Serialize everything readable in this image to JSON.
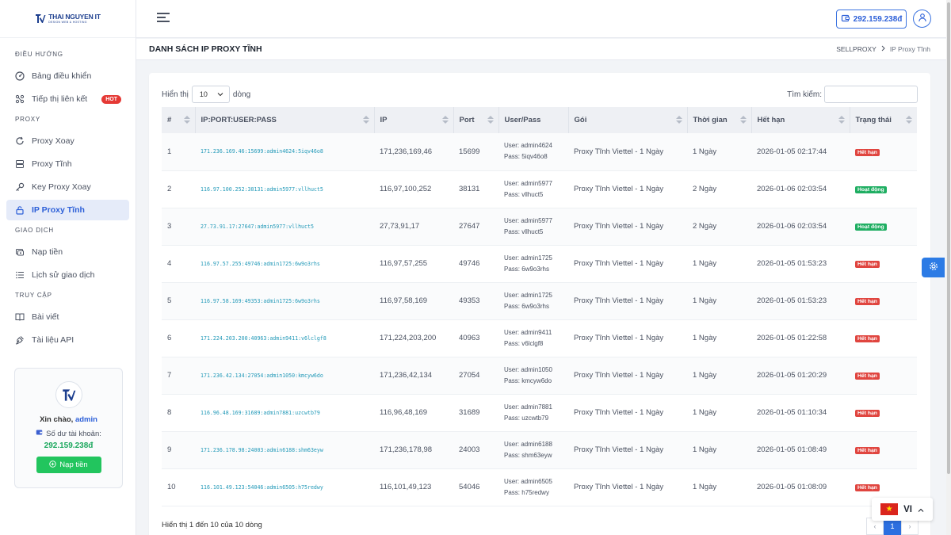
{
  "brand": {
    "name": "THAI NGUYEN IT",
    "tagline": "DESIGN WEB & HOSTING"
  },
  "sidebar": {
    "sections": [
      {
        "title": "ĐIỀU HƯỚNG",
        "items": [
          {
            "label": "Bảng điều khiển",
            "icon": "dashboard-icon"
          },
          {
            "label": "Tiếp thị liên kết",
            "icon": "share-icon",
            "badge": "HOT"
          }
        ]
      },
      {
        "title": "PROXY",
        "items": [
          {
            "label": "Proxy Xoay",
            "icon": "refresh-icon"
          },
          {
            "label": "Proxy Tĩnh",
            "icon": "server-icon"
          },
          {
            "label": "Key Proxy Xoay",
            "icon": "key-icon"
          },
          {
            "label": "IP Proxy Tĩnh",
            "icon": "lock-icon",
            "active": true
          }
        ]
      },
      {
        "title": "GIAO DỊCH",
        "items": [
          {
            "label": "Nạp tiền",
            "icon": "wallet-icon"
          },
          {
            "label": "Lịch sử giao dịch",
            "icon": "list-icon"
          }
        ]
      },
      {
        "title": "TRUY CẬP",
        "items": [
          {
            "label": "Bài viết",
            "icon": "book-icon"
          },
          {
            "label": "Tài liệu API",
            "icon": "plug-icon"
          }
        ]
      }
    ],
    "user_card": {
      "greeting": "Xin chào,",
      "username": "admin",
      "balance_label": "Số dư tài khoản:",
      "balance": "292.159.238đ",
      "topup_label": "Nạp tiền"
    }
  },
  "topbar": {
    "balance": "292.159.238đ"
  },
  "page": {
    "title": "DANH SÁCH IP PROXY TĨNH",
    "breadcrumb": [
      "SELLPROXY",
      "IP Proxy Tĩnh"
    ]
  },
  "table_controls": {
    "show_prefix": "Hiển thị",
    "page_size": "10",
    "show_suffix": "dòng",
    "search_label": "Tìm kiếm:",
    "search_value": ""
  },
  "table": {
    "columns": [
      "#",
      "IP:PORT:USER:PASS",
      "IP",
      "Port",
      "User/Pass",
      "Gói",
      "Thời gian",
      "Hết hạn",
      "Trạng thái"
    ],
    "user_prefix": "User:",
    "pass_prefix": "Pass:",
    "rows": [
      {
        "n": "1",
        "full": "171.236.169.46:15699:admin4624:5iqv46o8",
        "ip": "171,236,169,46",
        "port": "15699",
        "user": "admin4624",
        "pass": "5iqv46o8",
        "plan": "Proxy Tĩnh Viettel - 1 Ngày",
        "duration": "1 Ngày",
        "expires": "2026-01-05 02:17:44",
        "status": "Hết hạn",
        "status_kind": "expired"
      },
      {
        "n": "2",
        "full": "116.97.100.252:38131:admin5977:vllhuct5",
        "ip": "116,97,100,252",
        "port": "38131",
        "user": "admin5977",
        "pass": "vllhuct5",
        "plan": "Proxy Tĩnh Viettel - 1 Ngày",
        "duration": "2 Ngày",
        "expires": "2026-01-06 02:03:54",
        "status": "Hoạt động",
        "status_kind": "active"
      },
      {
        "n": "3",
        "full": "27.73.91.17:27647:admin5977:vllhuct5",
        "ip": "27,73,91,17",
        "port": "27647",
        "user": "admin5977",
        "pass": "vllhuct5",
        "plan": "Proxy Tĩnh Viettel - 1 Ngày",
        "duration": "2 Ngày",
        "expires": "2026-01-06 02:03:54",
        "status": "Hoạt động",
        "status_kind": "active"
      },
      {
        "n": "4",
        "full": "116.97.57.255:49746:admin1725:6w9o3rhs",
        "ip": "116,97,57,255",
        "port": "49746",
        "user": "admin1725",
        "pass": "6w9o3rhs",
        "plan": "Proxy Tĩnh Viettel - 1 Ngày",
        "duration": "1 Ngày",
        "expires": "2026-01-05 01:53:23",
        "status": "Hết hạn",
        "status_kind": "expired"
      },
      {
        "n": "5",
        "full": "116.97.58.169:49353:admin1725:6w9o3rhs",
        "ip": "116,97,58,169",
        "port": "49353",
        "user": "admin1725",
        "pass": "6w9o3rhs",
        "plan": "Proxy Tĩnh Viettel - 1 Ngày",
        "duration": "1 Ngày",
        "expires": "2026-01-05 01:53:23",
        "status": "Hết hạn",
        "status_kind": "expired"
      },
      {
        "n": "6",
        "full": "171.224.203.200:40963:admin9411:v6lclgf8",
        "ip": "171,224,203,200",
        "port": "40963",
        "user": "admin9411",
        "pass": "v6lclgf8",
        "plan": "Proxy Tĩnh Viettel - 1 Ngày",
        "duration": "1 Ngày",
        "expires": "2026-01-05 01:22:58",
        "status": "Hết hạn",
        "status_kind": "expired"
      },
      {
        "n": "7",
        "full": "171.236.42.134:27054:admin1050:kmcyw6do",
        "ip": "171,236,42,134",
        "port": "27054",
        "user": "admin1050",
        "pass": "kmcyw6do",
        "plan": "Proxy Tĩnh Viettel - 1 Ngày",
        "duration": "1 Ngày",
        "expires": "2026-01-05 01:20:29",
        "status": "Hết hạn",
        "status_kind": "expired"
      },
      {
        "n": "8",
        "full": "116.96.48.169:31689:admin7881:uzcwtb79",
        "ip": "116,96,48,169",
        "port": "31689",
        "user": "admin7881",
        "pass": "uzcwtb79",
        "plan": "Proxy Tĩnh Viettel - 1 Ngày",
        "duration": "1 Ngày",
        "expires": "2026-01-05 01:10:34",
        "status": "Hết hạn",
        "status_kind": "expired"
      },
      {
        "n": "9",
        "full": "171.236.178.98:24003:admin6188:shm63eyw",
        "ip": "171,236,178,98",
        "port": "24003",
        "user": "admin6188",
        "pass": "shm63eyw",
        "plan": "Proxy Tĩnh Viettel - 1 Ngày",
        "duration": "1 Ngày",
        "expires": "2026-01-05 01:08:49",
        "status": "Hết hạn",
        "status_kind": "expired"
      },
      {
        "n": "10",
        "full": "116.101.49.123:54046:admin6505:h75redwy",
        "ip": "116,101,49,123",
        "port": "54046",
        "user": "admin6505",
        "pass": "h75redwy",
        "plan": "Proxy Tĩnh Viettel - 1 Ngày",
        "duration": "1 Ngày",
        "expires": "2026-01-05 01:08:09",
        "status": "Hết hạn",
        "status_kind": "expired"
      }
    ]
  },
  "footer": {
    "info": "Hiển thị 1 đến 10 của 10 dòng",
    "pages": [
      "‹",
      "1",
      "›"
    ],
    "current_page": "1"
  },
  "language": {
    "code": "VI"
  },
  "colors": {
    "accent": "#2c5fd8",
    "success": "#1fae62",
    "danger": "#e0453f",
    "link": "#2299b8"
  }
}
